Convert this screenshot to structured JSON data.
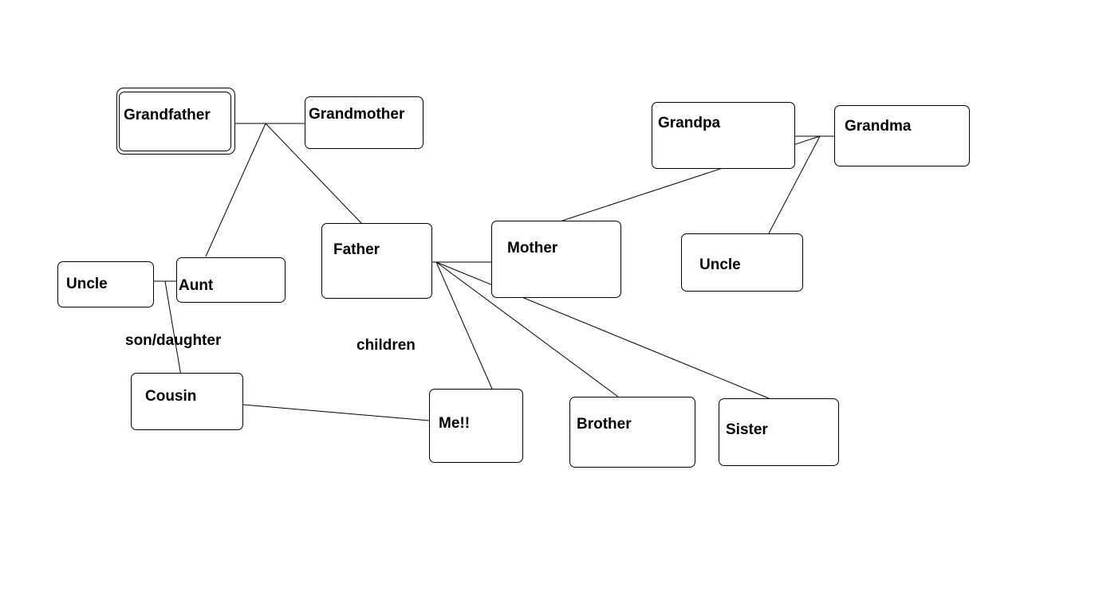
{
  "nodes": {
    "grandfather": "Grandfather",
    "grandmother": "Grandmother",
    "grandpa": "Grandpa",
    "grandma": "Grandma",
    "uncle_paternal": "Uncle",
    "aunt": "Aunt",
    "father": "Father",
    "mother": "Mother",
    "uncle_maternal": "Uncle",
    "cousin": "Cousin",
    "me": "Me!!",
    "brother": "Brother",
    "sister": "Sister"
  },
  "edge_labels": {
    "son_daughter": "son/daughter",
    "children": "children"
  },
  "colors": {
    "line": "#000000",
    "background": "#ffffff"
  }
}
